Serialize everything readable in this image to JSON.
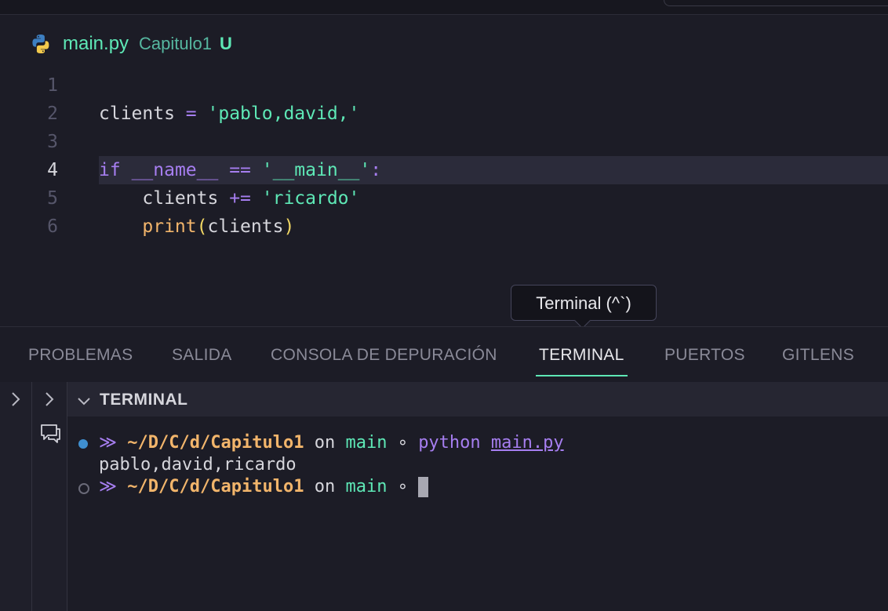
{
  "editor": {
    "file_name": "main.py",
    "folder": "Capitulo1",
    "git_status": "U",
    "active_line": 4,
    "lines": [
      {
        "num": "1"
      },
      {
        "num": "2"
      },
      {
        "num": "3"
      },
      {
        "num": "4"
      },
      {
        "num": "5"
      },
      {
        "num": "6"
      }
    ],
    "code": {
      "l2_var": "clients",
      "l2_op": "=",
      "l2_str": "'pablo,david,'",
      "l4_kw": "if",
      "l4_name": "__name__",
      "l4_op": "==",
      "l4_str": "'__main__'",
      "l4_colon": ":",
      "l5_var": "clients",
      "l5_op": "+=",
      "l5_str": "'ricardo'",
      "l6_fn": "print",
      "l6_open": "(",
      "l6_arg": "clients",
      "l6_close": ")"
    }
  },
  "tooltip": {
    "text": "Terminal (^`)"
  },
  "panel": {
    "tabs": [
      {
        "label": "PROBLEMAS"
      },
      {
        "label": "SALIDA"
      },
      {
        "label": "CONSOLA DE DEPURACIÓN"
      },
      {
        "label": "TERMINAL"
      },
      {
        "label": "PUERTOS"
      },
      {
        "label": "GITLENS"
      }
    ],
    "active_tab": "TERMINAL",
    "section_title": "TERMINAL"
  },
  "terminal": {
    "prompt_symbol": "≫",
    "line1": {
      "path": "~/D/C/d/Capitulo1",
      "on": "on",
      "branch": "main",
      "sep": "∘",
      "cmd": "python",
      "arg": "main.py"
    },
    "output": "pablo,david,ricardo",
    "line3": {
      "path": "~/D/C/d/Capitulo1",
      "on": "on",
      "branch": "main",
      "sep": "∘"
    }
  },
  "colors": {
    "accent": "#5ee8b6",
    "keyword": "#a67ef0",
    "function": "#f2b56b",
    "background": "#1c1c26"
  }
}
